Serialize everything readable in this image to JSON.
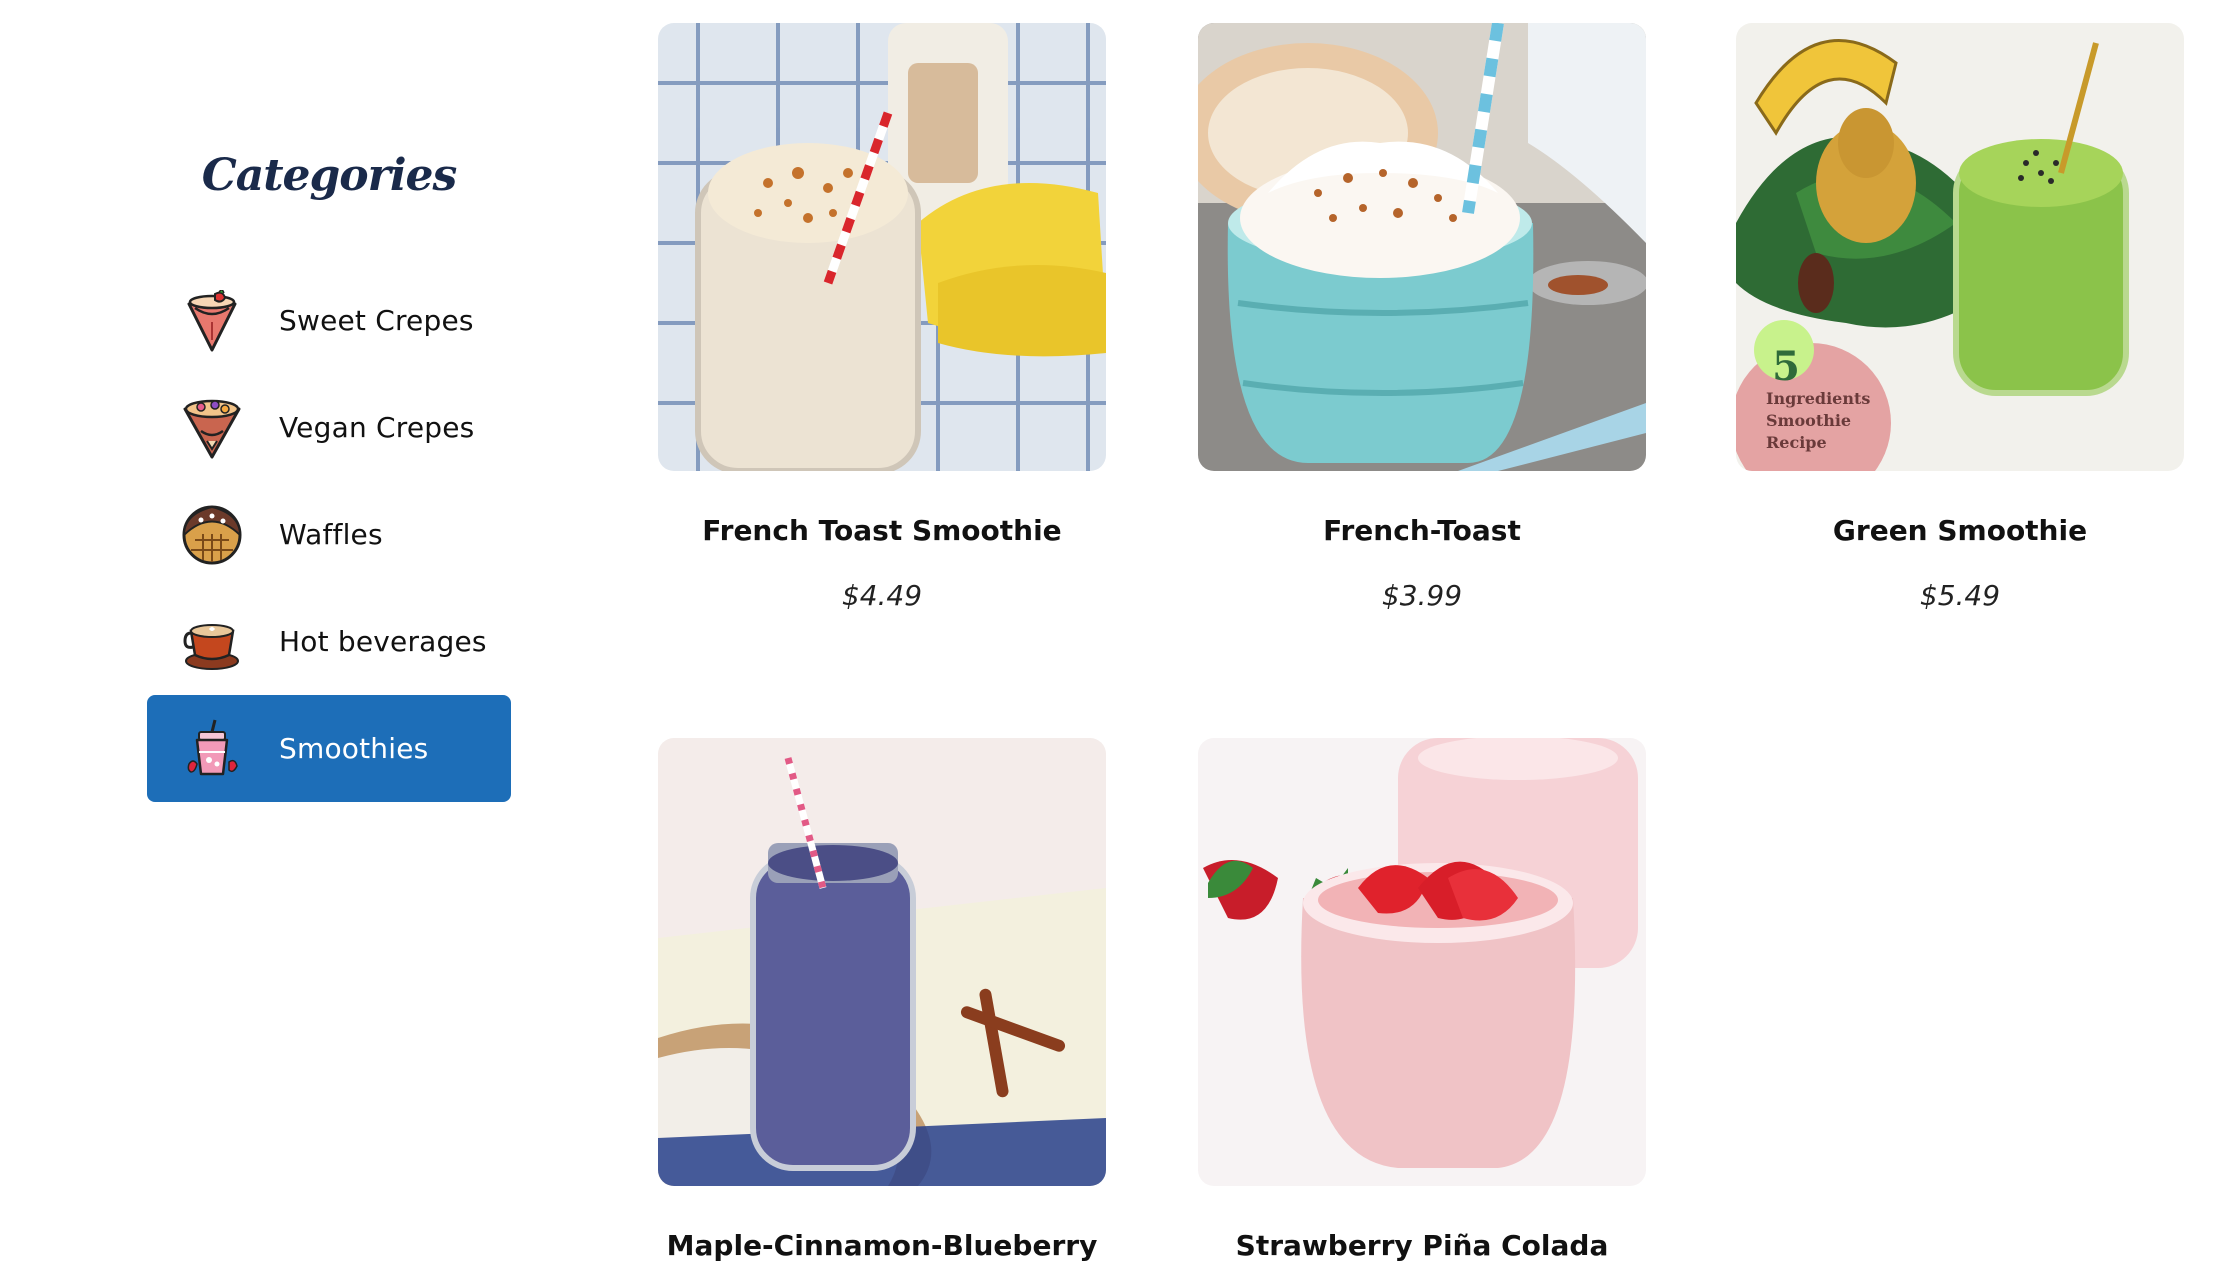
{
  "sidebar": {
    "title": "Categories",
    "items": [
      {
        "label": "Sweet Crepes",
        "icon": "crepe-icon",
        "active": false
      },
      {
        "label": "Vegan Crepes",
        "icon": "vegan-crepe-icon",
        "active": false
      },
      {
        "label": "Waffles",
        "icon": "waffle-icon",
        "active": false
      },
      {
        "label": "Hot beverages",
        "icon": "coffee-cup-icon",
        "active": false
      },
      {
        "label": "Smoothies",
        "icon": "smoothie-icon",
        "active": true
      }
    ],
    "active_color": "#1d6eb8"
  },
  "products": [
    {
      "name": "French Toast Smoothie",
      "price": "$4.49"
    },
    {
      "name": "French-Toast",
      "price": "$3.99"
    },
    {
      "name": "Green Smoothie",
      "price": "$5.49",
      "badge": {
        "number": "5",
        "line1": "Ingredients",
        "line2": "Smoothie",
        "line3": "Recipe"
      }
    },
    {
      "name": "Maple-Cinnamon-Blueberry",
      "price": ""
    },
    {
      "name": "Strawberry Piña Colada",
      "price": ""
    }
  ]
}
